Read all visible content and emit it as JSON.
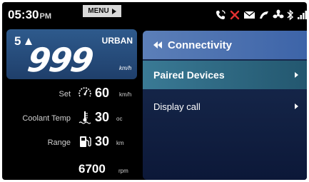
{
  "topbar": {
    "time": "05:30",
    "ampm": "PM",
    "menu_label": "MENU",
    "status_icons": [
      "phone-icon",
      "missed-call-icon",
      "message-icon",
      "navigation-icon",
      "fan-icon",
      "bluetooth-icon",
      "signal-icon",
      "battery-icon"
    ]
  },
  "dash": {
    "gear": "5",
    "mode": "URBAN",
    "speed": "999",
    "speed_unit": "km/h",
    "set_label": "Set",
    "set_value": "60",
    "set_unit": "km/h",
    "coolant_label": "Coolant Temp",
    "coolant_value": "30",
    "coolant_unit": "oc",
    "range_label": "Range",
    "range_value": "30",
    "range_unit": "km",
    "rpm_value": "6700",
    "rpm_unit": "rpm"
  },
  "panel": {
    "title": "Connectivity",
    "items": [
      {
        "label": "Paired Devices",
        "selected": true
      },
      {
        "label": "Display call",
        "selected": false
      }
    ]
  },
  "colors": {
    "header_bg": "#5c7fb8",
    "selected_item_bg": "#3a7a95",
    "panel_bg": "#1a2d52",
    "speed_card_bg": "#2e5a8c",
    "alert_red": "#e03030"
  }
}
